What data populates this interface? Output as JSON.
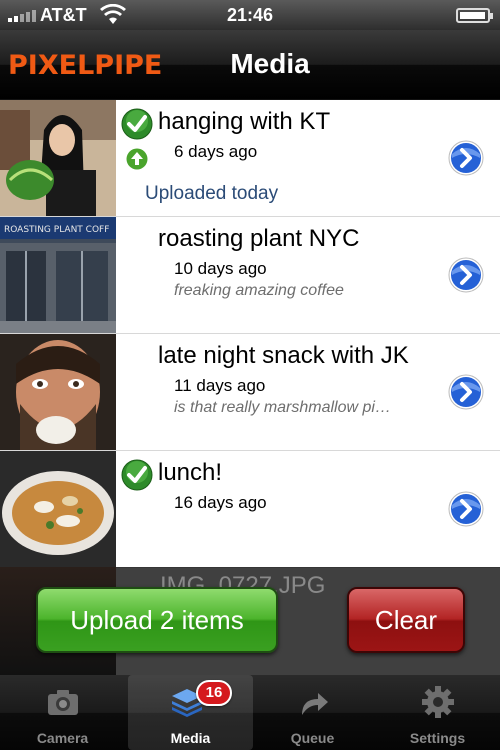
{
  "status_bar": {
    "carrier": "AT&T",
    "time": "21:46",
    "icons": [
      "signal-icon",
      "wifi-icon",
      "battery-icon"
    ]
  },
  "nav": {
    "brand": "PIXELPIPE",
    "title": "Media"
  },
  "media_items": [
    {
      "title": "hanging with KT",
      "date": "6 days ago",
      "description": "",
      "status": "Uploaded today",
      "checked": true,
      "uploaded": true
    },
    {
      "title": "roasting plant NYC",
      "date": "10 days ago",
      "description": "freaking amazing coffee",
      "status": "",
      "checked": false,
      "uploaded": false
    },
    {
      "title": "late night snack with JK",
      "date": "11 days ago",
      "description": "is that really marshmallow pi…",
      "status": "",
      "checked": false,
      "uploaded": false
    },
    {
      "title": "lunch!",
      "date": "16 days ago",
      "description": "",
      "status": "",
      "checked": true,
      "uploaded": false
    },
    {
      "title": "IMG_0727.JPG",
      "date": "",
      "description": "",
      "status": "",
      "checked": false,
      "uploaded": false
    }
  ],
  "actions": {
    "upload_label": "Upload 2 items",
    "clear_label": "Clear"
  },
  "tabs": [
    {
      "label": "Camera",
      "icon": "camera-icon",
      "selected": false
    },
    {
      "label": "Media",
      "icon": "media-stack-icon",
      "selected": true,
      "badge": "16"
    },
    {
      "label": "Queue",
      "icon": "queue-arrow-icon",
      "selected": false
    },
    {
      "label": "Settings",
      "icon": "gear-icon",
      "selected": false
    }
  ],
  "colors": {
    "brand": "#f05a14",
    "upload_button": "#3aa021",
    "clear_button": "#a81b1b",
    "status_text": "#2b4b77",
    "badge": "#d5191d"
  }
}
